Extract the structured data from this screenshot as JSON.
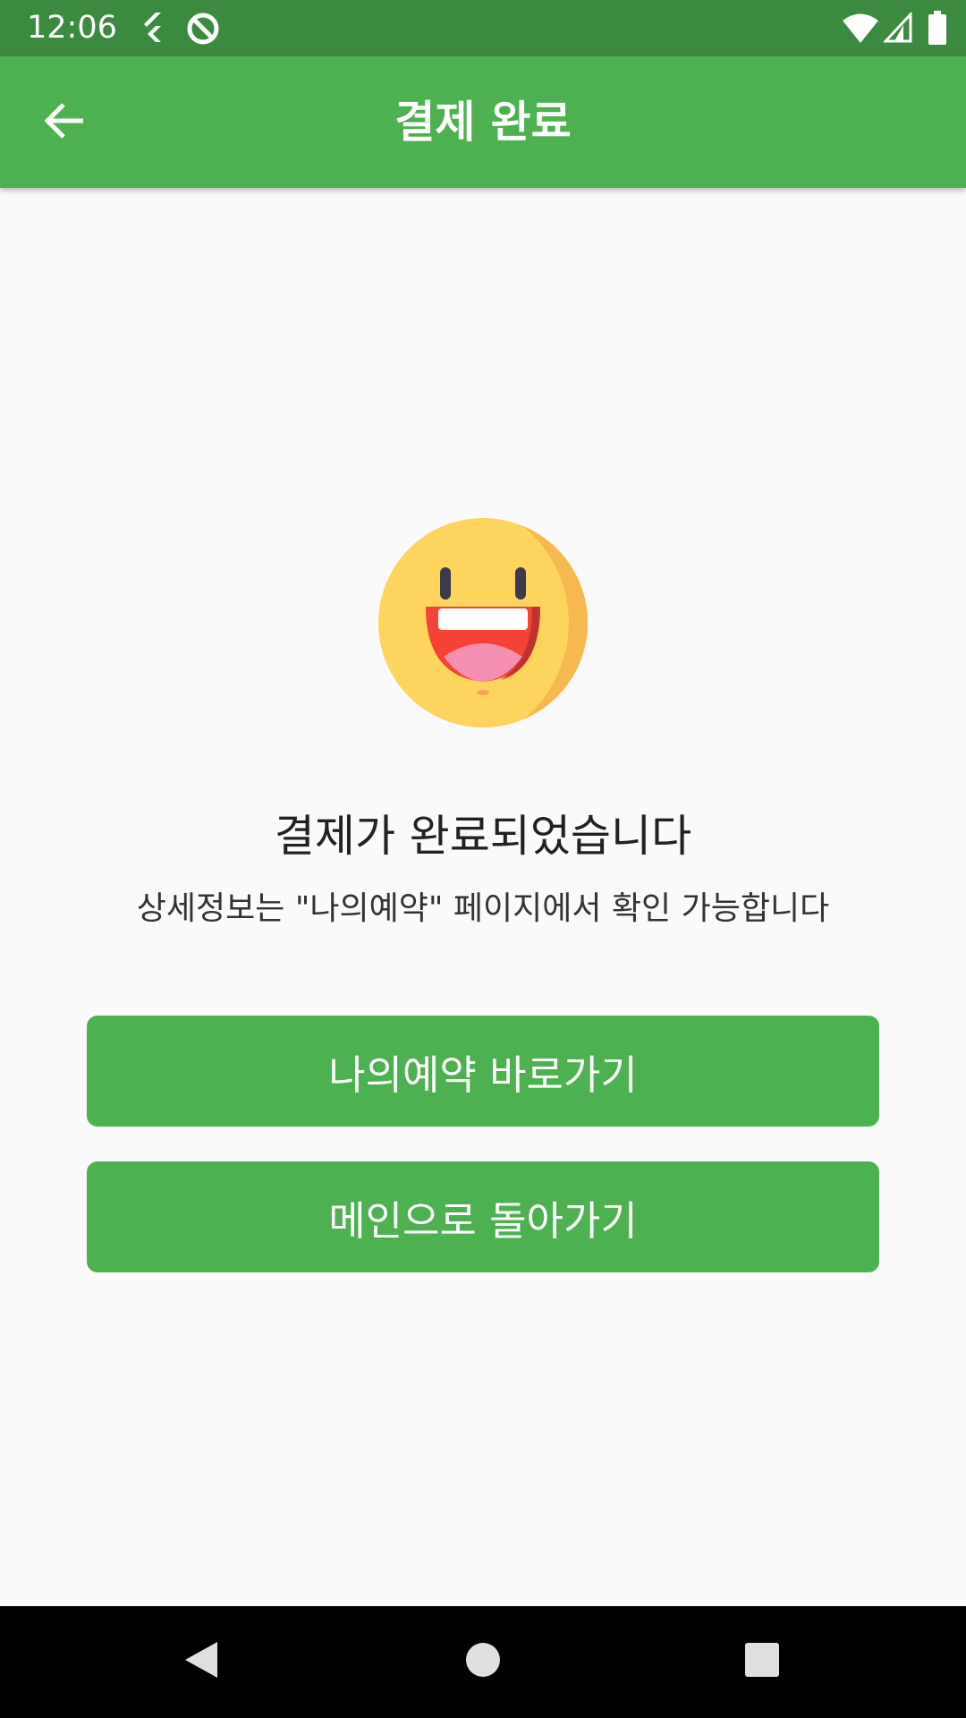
{
  "status_bar": {
    "time": "12:06",
    "icons": [
      "flutter-icon",
      "no-disturb-icon",
      "wifi-icon",
      "cellular-signal-icon",
      "battery-icon"
    ]
  },
  "app_bar": {
    "title": "결제 완료",
    "back_icon": "arrow-back-icon",
    "color": "#4db051"
  },
  "content": {
    "emoji_icon": "grinning-face-icon",
    "heading": "결제가 완료되었습니다",
    "subtext": "상세정보는 \"나의예약\" 페이지에서 확인 가능합니다"
  },
  "buttons": {
    "my_reservation": "나의예약 바로가기",
    "go_main": "메인으로 돌아가기"
  },
  "nav_bar": {
    "icons": [
      "back-triangle-icon",
      "home-circle-icon",
      "recents-square-icon"
    ]
  },
  "colors": {
    "status_bar": "#3c8a40",
    "accent": "#4db051",
    "background": "#fafafa"
  }
}
